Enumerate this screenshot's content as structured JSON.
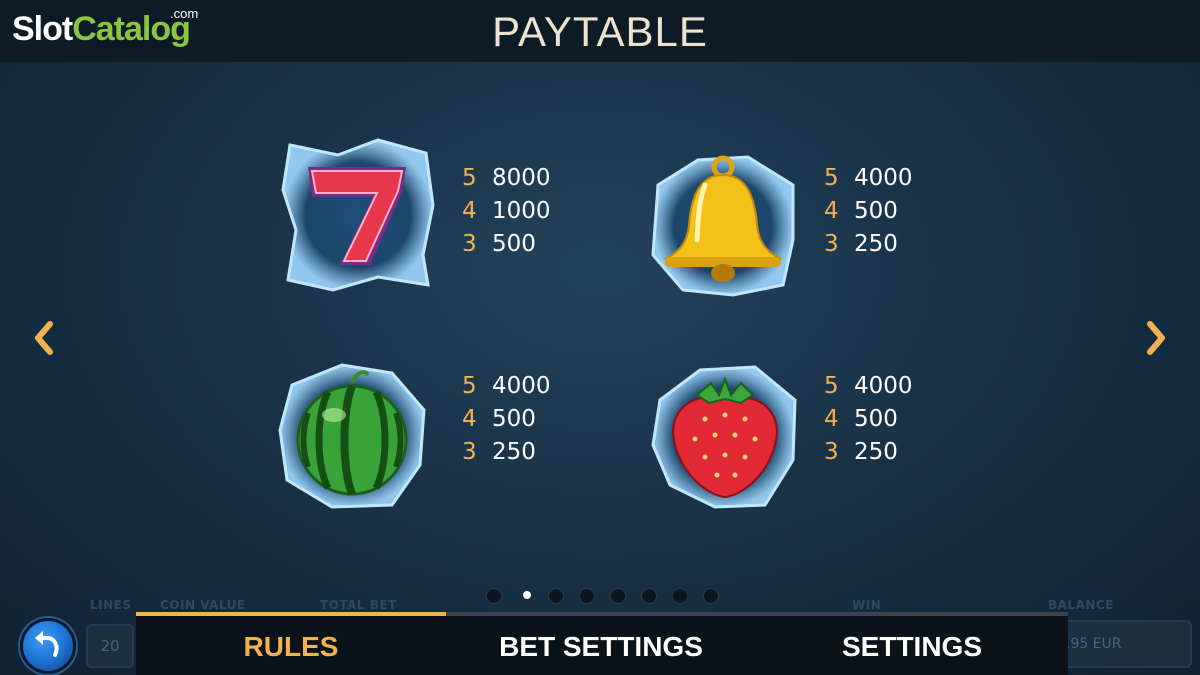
{
  "logo": {
    "slot": "Slot",
    "catalog": "Catalog",
    "com": ".com"
  },
  "title": "PAYTABLE",
  "symbols": [
    {
      "icon": "seven-icon",
      "pays": [
        {
          "count": "5",
          "value": "8000"
        },
        {
          "count": "4",
          "value": "1000"
        },
        {
          "count": "3",
          "value": "500"
        }
      ]
    },
    {
      "icon": "bell-icon",
      "pays": [
        {
          "count": "5",
          "value": "4000"
        },
        {
          "count": "4",
          "value": "500"
        },
        {
          "count": "3",
          "value": "250"
        }
      ]
    },
    {
      "icon": "watermelon-icon",
      "pays": [
        {
          "count": "5",
          "value": "4000"
        },
        {
          "count": "4",
          "value": "500"
        },
        {
          "count": "3",
          "value": "250"
        }
      ]
    },
    {
      "icon": "strawberry-icon",
      "pays": [
        {
          "count": "5",
          "value": "4000"
        },
        {
          "count": "4",
          "value": "500"
        },
        {
          "count": "3",
          "value": "250"
        }
      ]
    }
  ],
  "pager": {
    "total": 8,
    "active_index": 1
  },
  "background_labels": {
    "lines": "LINES",
    "coin_value": "COIN VALUE",
    "total_bet": "TOTAL BET",
    "win": "WIN",
    "balance": "BALANCE"
  },
  "lines_value": "20",
  "balance_value": ".95 EUR",
  "tabs": [
    {
      "label": "RULES"
    },
    {
      "label": "BET SETTINGS"
    },
    {
      "label": "SETTINGS"
    }
  ],
  "colors": {
    "accent": "#f2b24e",
    "logo_green": "#8bc53f",
    "title": "#ece4cf"
  }
}
